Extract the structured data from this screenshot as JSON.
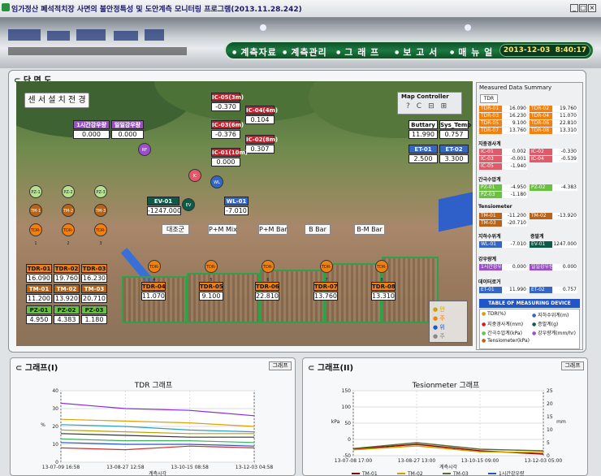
{
  "window": {
    "title": "임가정산 폐석적치장 사면의 불안정특성 및 도안계측 모니터링 프로그램(2013.11.28.242)",
    "buttons": [
      "_",
      "□",
      "×"
    ]
  },
  "nav": {
    "items": [
      "계측자료",
      "계측관리",
      "그 래 프",
      "보 고 서",
      "매 뉴 얼"
    ],
    "date": "2013-12-03",
    "time": "8:40:17"
  },
  "section_title": "단 면 도",
  "install_button": "센 서 설 치 전 경",
  "map_controller": {
    "title": "Map Controller",
    "tools": [
      "?",
      "C",
      "⊟",
      "⊞"
    ]
  },
  "rain": {
    "labels": [
      "1시간강우량",
      "일일강우량"
    ],
    "values": [
      "0.000",
      "0.000"
    ]
  },
  "inclinometers": [
    {
      "label": "IC-05(3m)",
      "value": "-0.370"
    },
    {
      "label": "IC-04(4m)",
      "value": "0.104"
    },
    {
      "label": "IC-03(6m)",
      "value": "-0.376"
    },
    {
      "label": "IC-02(8m)",
      "value": "0.307"
    },
    {
      "label": "IC-01(10m)",
      "value": "0.000"
    }
  ],
  "status": {
    "labels": [
      "Buttary",
      "Sys_Temp"
    ],
    "values": [
      "11.990",
      "0.757"
    ]
  },
  "et": {
    "labels": [
      "ET-01",
      "ET-02"
    ],
    "values": [
      "2.500",
      "3.300"
    ]
  },
  "ev": {
    "label": "EV-01",
    "value": "-1247.000"
  },
  "wl": {
    "label": "WL-01",
    "value": "-7.010"
  },
  "markers": {
    "rf": "RF",
    "ic": "IC",
    "wl": "WL",
    "ev": "EV",
    "pz": [
      "PZ-1",
      "PZ-2",
      "PZ-3"
    ],
    "tm": [
      "TM-1",
      "TM-2",
      "TM-3"
    ],
    "tdr_left": [
      "TDR-1",
      "TDR-2",
      "TDR-3"
    ],
    "tdr_net": [
      "TDR-4",
      "TDR-5",
      "TDR-6",
      "TDR-7",
      "TDR-8"
    ]
  },
  "sections": [
    "대조군",
    "P+M Mix",
    "P+M Bar",
    "B Bar",
    "B-M Bar"
  ],
  "left_table": {
    "tdr_labels": [
      "TDR-01",
      "TDR-02",
      "TDR-03"
    ],
    "tdr_values": [
      "16.090",
      "19.760",
      "16.230"
    ],
    "tm_labels": [
      "TM-01",
      "TM-02",
      "TM-03"
    ],
    "tm_values": [
      "11.200",
      "13.920",
      "20.710"
    ],
    "pz_labels": [
      "PZ-01",
      "PZ-02",
      "PZ-03"
    ],
    "pz_values": [
      "4.950",
      "4.383",
      "1.180"
    ]
  },
  "net_tdr": [
    {
      "label": "TDR-04",
      "value": "11.070"
    },
    {
      "label": "TDR-05",
      "value": "9.100"
    },
    {
      "label": "TDR-06",
      "value": "22.810"
    },
    {
      "label": "TDR-07",
      "value": "13.760"
    },
    {
      "label": "TDR-08",
      "value": "13.310"
    }
  ],
  "scene_legend": [
    "안",
    "주",
    "위",
    "주"
  ],
  "summary": {
    "title": "Measured Data Summary",
    "tab": "TDR",
    "tdr": [
      [
        "TDR-01",
        "16.090",
        "TDR-02",
        "19.760"
      ],
      [
        "TDR-03",
        "16.230",
        "TDR-04",
        "11.070"
      ],
      [
        "TDR-05",
        "9.100",
        "TDR-06",
        "22.810"
      ],
      [
        "TDR-07",
        "13.760",
        "TDR-08",
        "13.310"
      ]
    ],
    "section_ic": "지중경사계",
    "ic": [
      [
        "IC-01",
        "0.002",
        "IC-02",
        "-0.330"
      ],
      [
        "IC-03",
        "-0.001",
        "IC-04",
        "-0.539"
      ],
      [
        "IC-05",
        "-1.940",
        "",
        ""
      ]
    ],
    "section_pz": "간극수압계",
    "pz": [
      [
        "PZ-01",
        "-4.950",
        "PZ-02",
        "-4.383"
      ],
      [
        "PZ-03",
        "-1.180",
        "",
        ""
      ]
    ],
    "section_tm": "Tensiometer",
    "tm": [
      [
        "TM-01",
        "-11.200",
        "TM-02",
        "-13.920"
      ],
      [
        "TM-03",
        "-20.710",
        "",
        ""
      ]
    ],
    "section_wl_ev": [
      "지하수위계",
      "증발계"
    ],
    "wl_ev": [
      "WL-01",
      "-7.010",
      "EV-01",
      "1247.000"
    ],
    "section_rain": "강우량계",
    "rain": [
      "1시간강우량",
      "0.000",
      "일일강우량",
      "0.000"
    ],
    "section_etc": "데이터로거",
    "etc": [
      "ET-01",
      "11.990",
      "ET-02",
      "0.757"
    ],
    "device_title": "TABLE OF MEASURING DEVICE",
    "devices": [
      "TDR(%)",
      "지하수위계(m)",
      "지중경사계(mm)",
      "증발계(g)",
      "간극수압계(kPa)",
      "강우량계(mm/hr)",
      "Tensiometer(kPa)"
    ]
  },
  "graph1": {
    "panel_title": "그래프(I)",
    "button": "그래프",
    "chart_title": "TDR 그래프",
    "xlabel": "계측시각",
    "ylabel": "%",
    "xticks": [
      "13-07-09 16:58",
      "13-08-27 12:58",
      "13-10-15 08:58",
      "13-12-03 04:58"
    ],
    "yticks": [
      "0",
      "10",
      "20",
      "30",
      "40"
    ]
  },
  "graph2": {
    "panel_title": "그래프(II)",
    "button": "그래프",
    "chart_title": "Tesionmeter 그래프",
    "xlabel": "계측시각",
    "ylabel_left": "kPa",
    "ylabel_right": "mm",
    "xticks": [
      "13-07-08 17:00",
      "13-08-27 13:00",
      "13-10-15 09:00",
      "13-12-03 05:00"
    ],
    "yticks_left": [
      "-50",
      "0",
      "50",
      "100",
      "150"
    ],
    "yticks_right": [
      "0",
      "5",
      "10",
      "15",
      "20",
      "25"
    ],
    "legend": [
      "TM-01",
      "TM-02",
      "TM-03",
      "1시간강우량"
    ]
  },
  "colors": {
    "tdr": "#f08010",
    "tm": "#b5641a",
    "pz": "#6ac040",
    "ic": "#c0202a",
    "et": "#3565c5",
    "rain": "#9b4fc9",
    "ev": "#0d5a48",
    "device_head": "#2255c8"
  },
  "chart_data": [
    {
      "type": "line",
      "title": "TDR 그래프",
      "xlabel": "계측시각",
      "ylabel": "%",
      "x": [
        "13-07-09 16:58",
        "13-08-27 12:58",
        "13-10-15 08:58",
        "13-12-03 04:58"
      ],
      "ylim": [
        0,
        40
      ],
      "series": [
        {
          "values": [
            33,
            30,
            29,
            26
          ]
        },
        {
          "values": [
            24,
            23,
            22,
            20
          ]
        },
        {
          "values": [
            21,
            20,
            18,
            17
          ]
        },
        {
          "values": [
            18,
            17,
            16,
            16
          ]
        },
        {
          "values": [
            16,
            15,
            14,
            14
          ]
        },
        {
          "values": [
            13,
            12,
            12,
            11
          ]
        },
        {
          "values": [
            11,
            10,
            10,
            9
          ]
        },
        {
          "values": [
            8,
            7,
            9,
            8
          ]
        }
      ]
    },
    {
      "type": "line",
      "title": "Tesionmeter 그래프",
      "xlabel": "계측시각",
      "x": [
        "13-07-08 17:00",
        "13-08-27 13:00",
        "13-10-15 09:00",
        "13-12-03 05:00"
      ],
      "ylim": [
        -50,
        150
      ],
      "series": [
        {
          "name": "TM-01",
          "values": [
            -30,
            -15,
            -35,
            -45
          ]
        },
        {
          "name": "TM-02",
          "values": [
            -32,
            -20,
            -38,
            -40
          ]
        },
        {
          "name": "TM-03",
          "values": [
            -28,
            -10,
            -30,
            -35
          ]
        }
      ]
    }
  ]
}
